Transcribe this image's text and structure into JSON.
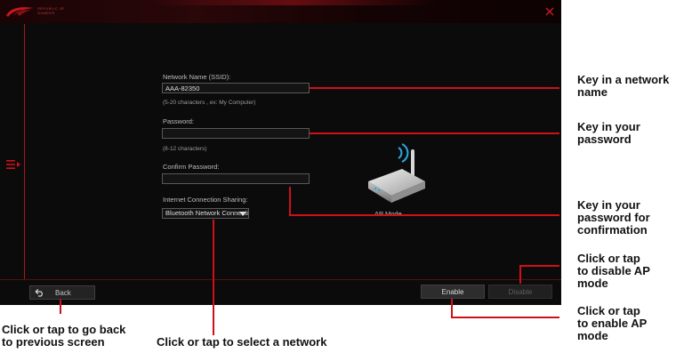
{
  "app": {
    "brand_line1": "REPUBLIC OF",
    "brand_line2": "GAMERS",
    "close_icon": "close-icon",
    "menu_icon": "menu-expand-icon",
    "accent_color": "#d01018"
  },
  "form": {
    "ssid_label": "Network Name (SSID):",
    "ssid_value": "AAA-82350",
    "ssid_hint": "(5-20 characters , ex: My Computer)",
    "password_label": "Password:",
    "password_value": "",
    "password_hint": "(8-12 characters)",
    "confirm_label": "Confirm Password:",
    "confirm_value": "",
    "sharing_label": "Internet Connection Sharing:",
    "sharing_selected": "Bluetooth Network Connecti"
  },
  "ap": {
    "icon": "wifi-router-icon",
    "label": "AP Mode"
  },
  "buttons": {
    "back_icon": "back-arrow-icon",
    "back": "Back",
    "enable": "Enable",
    "disable": "Disable"
  },
  "callouts": {
    "network_name_l1": "Key in a network",
    "network_name_l2": "name",
    "password_l1": "Key in your",
    "password_l2": "password",
    "confirm_l1": "Key in your",
    "confirm_l2": "password for",
    "confirm_l3": "confirmation",
    "disable_l1": "Click or tap",
    "disable_l2": "to disable AP",
    "disable_l3": "mode",
    "enable_l1": "Click or tap",
    "enable_l2": "to enable AP",
    "enable_l3": "mode",
    "back_l1": "Click or tap to go back",
    "back_l2": "to previous screen",
    "select_network": "Click or tap to select a network"
  }
}
